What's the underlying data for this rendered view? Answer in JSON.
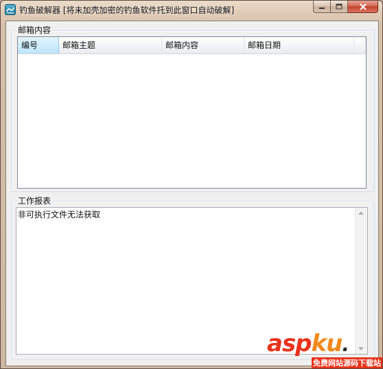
{
  "window": {
    "title": "钓鱼破解器 [将未加壳加密的钓鱼软件托到此窗口自动破解]",
    "icon": "app-icon"
  },
  "mailbox_group": {
    "label": "邮箱内容",
    "columns": [
      "编号",
      "邮箱主题",
      "邮箱内容",
      "邮箱日期"
    ],
    "rows": []
  },
  "report_group": {
    "label": "工作报表",
    "log_text": "非可执行文件无法获取"
  },
  "watermark": {
    "brand": "asp",
    "brand2": "ku",
    "dot": ".",
    "tagline": "免费网站源码下载站"
  }
}
